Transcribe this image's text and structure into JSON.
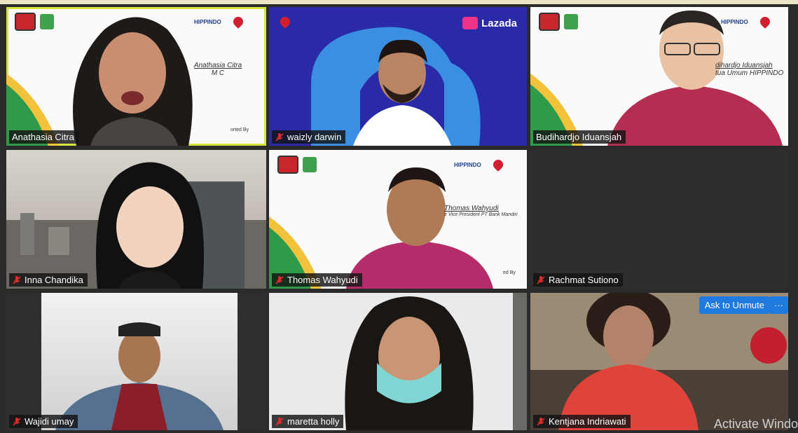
{
  "tiles": [
    {
      "name": "Anathasia Citra",
      "muted": false,
      "active": true
    },
    {
      "name": "waizly darwin",
      "muted": true,
      "active": false
    },
    {
      "name": "Budihardjo Iduansjah",
      "muted": false,
      "active": false
    },
    {
      "name": "Inna Chandika",
      "muted": true,
      "active": false
    },
    {
      "name": "Thomas Wahyudi",
      "muted": true,
      "active": false
    },
    {
      "name": "Rachmat Sutiono",
      "muted": true,
      "active": false
    },
    {
      "name": "Wajidi umay",
      "muted": true,
      "active": false
    },
    {
      "name": "maretta holly",
      "muted": true,
      "active": false
    },
    {
      "name": "Kentjana Indriawati",
      "muted": true,
      "active": false
    }
  ],
  "overlays": {
    "anathasia_name": "Anathasia Citra",
    "anathasia_role": "M C",
    "anathasia_footer": "orted By",
    "budi_name": "dihardjo Iduansjah",
    "budi_role": "tua Umum HIPPINDO",
    "thomas_name": "Thomas Wahyudi",
    "thomas_role": "e Vice President PT Bank Mandiri",
    "thomas_footer": "ed By",
    "lazada_brand": "Lazada",
    "hippindo_brand": "HIPPINDO"
  },
  "controls": {
    "ask_to_unmute": "Ask to Unmute",
    "more": "···"
  },
  "watermark": "Activate Windo",
  "colors": {
    "active_border": "#d6e33a",
    "accent_blue": "#1f7ae0",
    "lazada_bg": "#2a2aa8"
  }
}
